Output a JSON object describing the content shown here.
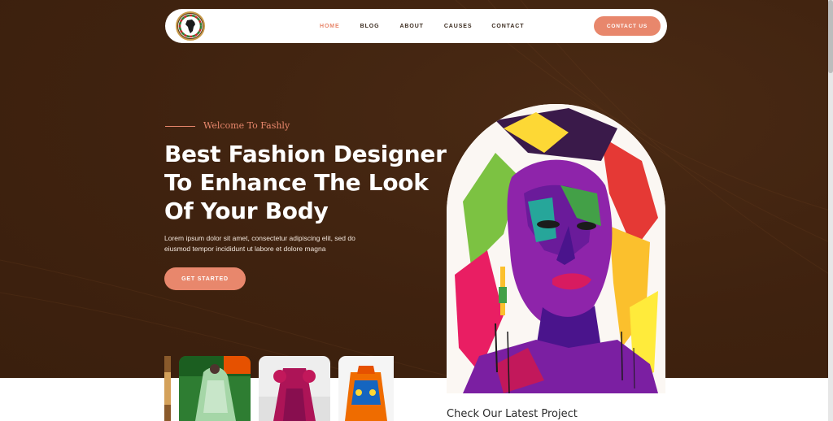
{
  "nav": {
    "logo_icon": "africa-emblem-logo",
    "links": [
      {
        "label": "HOME",
        "active": true
      },
      {
        "label": "BLOG",
        "active": false
      },
      {
        "label": "ABOUT",
        "active": false
      },
      {
        "label": "CAUSES",
        "active": false
      },
      {
        "label": "CONTACT",
        "active": false
      }
    ],
    "cta_label": "CONTACT US"
  },
  "hero": {
    "eyebrow": "Welcome To Fashly",
    "headline_lines": [
      "Best Fashion Designer",
      "To Enhance The Look",
      "Of Your Body"
    ],
    "body_lines": [
      "Lorem ipsum dolor sit amet, consectetur adipiscing elit, sed do",
      "eiusmod tempor incididunt ut labore et dolore magna"
    ],
    "button_label": "GET STARTED"
  },
  "gallery": {
    "images": [
      "partial-fashion-image",
      "green-lace-dress-image",
      "red-sequin-gown-image",
      "orange-african-print-outfit-image"
    ]
  },
  "projects": {
    "title": "Check Our Latest Project"
  },
  "colors": {
    "hero_background": "#3f220f",
    "accent": "#e8876c",
    "text_light": "#ffffff"
  }
}
